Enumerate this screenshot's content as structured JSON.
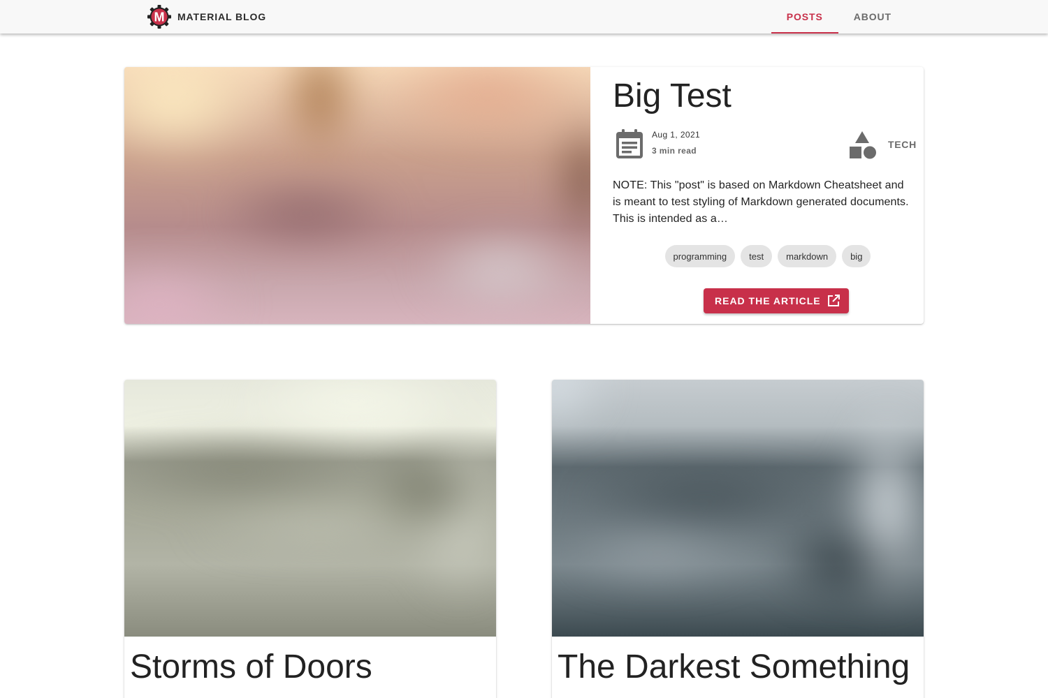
{
  "brand": {
    "name": "MATERIAL BLOG",
    "logo_letter": "M",
    "accent": "#c8304a"
  },
  "nav": {
    "tabs": [
      {
        "label": "POSTS",
        "active": true
      },
      {
        "label": "ABOUT",
        "active": false
      }
    ]
  },
  "featured": {
    "title": "Big Test",
    "date": "Aug 1, 2021",
    "read_time": "3 min read",
    "category": "TECH",
    "excerpt": "NOTE: This \"post\" is based on Markdown Cheatsheet and is meant to test styling of Markdown generated documents. This is intended as a…",
    "tags": [
      "programming",
      "test",
      "markdown",
      "big"
    ],
    "cta_label": "READ THE ARTICLE",
    "icons": {
      "date": "calendar-icon",
      "category": "shapes-icon",
      "cta": "open-in-new-icon"
    }
  },
  "posts": [
    {
      "title": "Storms of Doors"
    },
    {
      "title": "The Darkest Something"
    }
  ]
}
